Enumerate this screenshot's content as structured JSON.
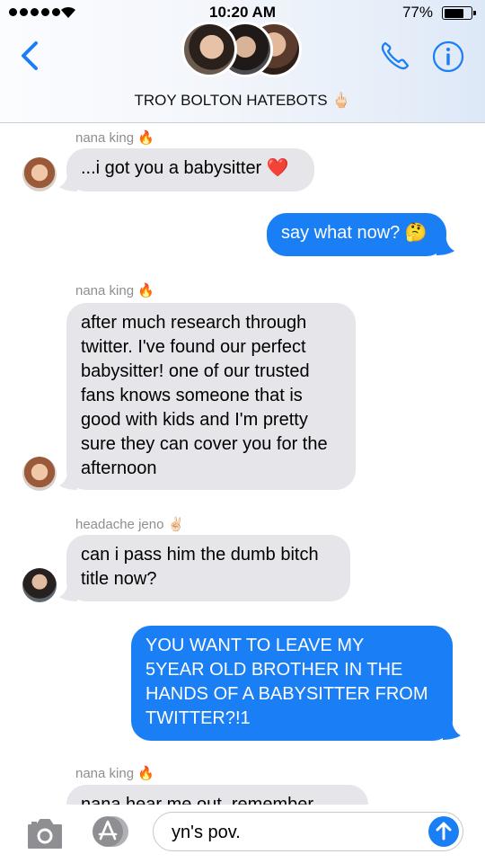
{
  "status_bar": {
    "time": "10:20 AM",
    "battery": "77%",
    "battery_level": 0.77
  },
  "header": {
    "group_name": "TROY BOLTON HATEBOTS 🖕🏻"
  },
  "messages": [
    {
      "sender": "nana king 🔥",
      "text": "...i got you a babysitter ❤️"
    },
    {
      "text": "say what now? 🤔"
    },
    {
      "sender": "nana king 🔥",
      "text": "after much research through\ntwitter. I've found our perfect\nbabysitter! one of our trusted\nfans knows someone that is\ngood with kids and I'm pretty\nsure they can cover you for the\nafternoon"
    },
    {
      "sender": "headache jeno ✌🏻",
      "text": "can i pass him the dumb bitch\ntitle now?"
    },
    {
      "text": "YOU WANT TO LEAVE MY\n5YEAR OLD BROTHER IN THE\nHANDS OF A BABYSITTER FROM\nTWITTER?!1"
    },
    {
      "sender": "nana king 🔥",
      "text": "nana hear me out, remember"
    }
  ],
  "input": {
    "value": "yn's pov."
  },
  "icons": {
    "back": "chevron-left-icon",
    "call": "phone-icon",
    "details": "info-icon",
    "camera": "camera-icon",
    "apps": "app-store-icon",
    "send": "arrow-up-icon"
  },
  "colors": {
    "accent": "#1a7ef5",
    "incoming_bubble": "#e5e5ea",
    "sender_label": "#8e8e93"
  }
}
